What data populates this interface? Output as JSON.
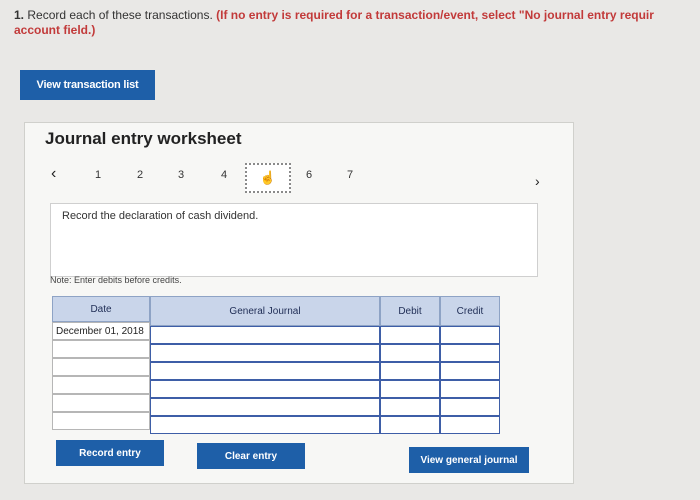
{
  "instruction": {
    "number": "1.",
    "text": "Record each of these transactions.",
    "note_line1": "(If no entry is required for a transaction/event, select \"No journal entry requir",
    "note_line2": "account field.)"
  },
  "view_transaction_list_label": "View transaction list",
  "worksheet": {
    "title": "Journal entry worksheet",
    "pager": {
      "prev_icon": "chevron-left-icon",
      "next_icon": "chevron-right-icon",
      "pages": [
        "1",
        "2",
        "3",
        "4",
        "",
        "6",
        "7"
      ],
      "current_icon": "hand-pointer-icon"
    },
    "description": "Record the declaration of cash dividend.",
    "note": "Note: Enter debits before credits."
  },
  "journal_table": {
    "headers": {
      "date": "Date",
      "general_journal": "General Journal",
      "debit": "Debit",
      "credit": "Credit"
    },
    "rows": [
      {
        "date": "December 01, 2018",
        "account": "",
        "debit": "",
        "credit": ""
      },
      {
        "date": "",
        "account": "",
        "debit": "",
        "credit": ""
      },
      {
        "date": "",
        "account": "",
        "debit": "",
        "credit": ""
      },
      {
        "date": "",
        "account": "",
        "debit": "",
        "credit": ""
      },
      {
        "date": "",
        "account": "",
        "debit": "",
        "credit": ""
      },
      {
        "date": "",
        "account": "",
        "debit": "",
        "credit": ""
      }
    ]
  },
  "buttons": {
    "record_entry": "Record entry",
    "clear_entry": "Clear entry",
    "view_general_journal": "View general journal"
  },
  "colors": {
    "button_blue": "#1e5fa8",
    "header_blue": "#c9d5ea",
    "instruction_red": "#c23a3a"
  }
}
